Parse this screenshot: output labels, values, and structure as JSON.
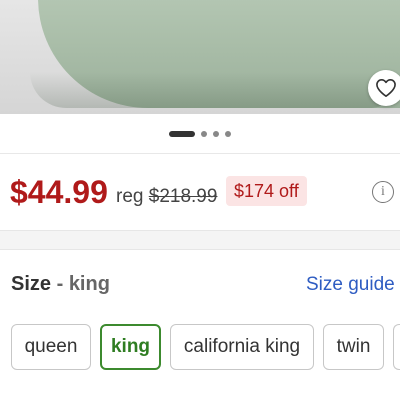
{
  "product": {
    "image_alt": "",
    "carousel": {
      "count": 4,
      "active": 0
    }
  },
  "pricing": {
    "current": "$44.99",
    "reg_label": "reg",
    "reg_price": "$218.99",
    "savings_badge": "$174 off",
    "info_symbol": "i"
  },
  "size": {
    "label": "Size",
    "separator": " - ",
    "selected": "king",
    "guide_link": "Size guide",
    "options": [
      "queen",
      "king",
      "california king",
      "twin"
    ]
  },
  "colors": {
    "price_red": "#b01a1a",
    "savings_bg": "#fbe4e4",
    "selected_green": "#3c8a2e",
    "link_blue": "#2e5cc2",
    "fabric_sage": "#b2c5b1"
  },
  "icons": {
    "favorite": "heart-icon",
    "info": "info-icon"
  }
}
